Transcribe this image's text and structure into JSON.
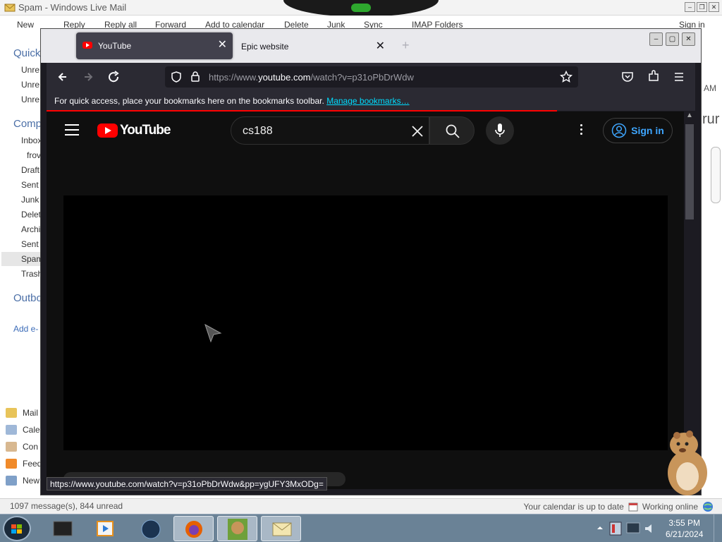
{
  "wlm": {
    "title": "Spam - Windows Live Mail",
    "toolbar": [
      "New",
      "Reply",
      "Reply all",
      "Forward",
      "Add to calendar",
      "Delete",
      "Junk",
      "Sync",
      "IMAP Folders",
      "Sign in"
    ],
    "sections": {
      "quick": "Quick",
      "comp": "Comp",
      "outbox": "Outbo"
    },
    "quick_items": [
      "Unre",
      "Unre",
      "Unre"
    ],
    "folders": [
      "Inbox",
      "frov",
      "Draft",
      "Sent",
      "Junk",
      "Delet",
      "Archi",
      "Sent",
      "Spam",
      "Trash"
    ],
    "add_account": "Add e-",
    "nav": [
      "Mail",
      "Cale",
      "Con",
      "Feed",
      "New"
    ],
    "right_time": "AM",
    "right_text": "rur",
    "status_left": "1097 message(s), 844 unread",
    "status_calendar": "Your calendar is up to date",
    "status_online": "Working online"
  },
  "firefox": {
    "tabs": [
      {
        "label": "YouTube",
        "active": true
      },
      {
        "label": "Epic website",
        "active": false
      }
    ],
    "url_prefix": "https://www.",
    "url_domain": "youtube.com",
    "url_rest": "/watch?v=p31oPbDrWdw",
    "bookmarks_text": "For quick access, place your bookmarks here on the bookmarks toolbar.",
    "bookmarks_link": "Manage bookmarks…",
    "status_link": "https://www.youtube.com/watch?v=p31oPbDrWdw&pp=ygUFY3MxODg="
  },
  "youtube": {
    "logo": "YouTube",
    "search_value": "cs188",
    "signin": "Sign in"
  },
  "taskbar": {
    "time": "3:55 PM",
    "date": "6/21/2024"
  }
}
